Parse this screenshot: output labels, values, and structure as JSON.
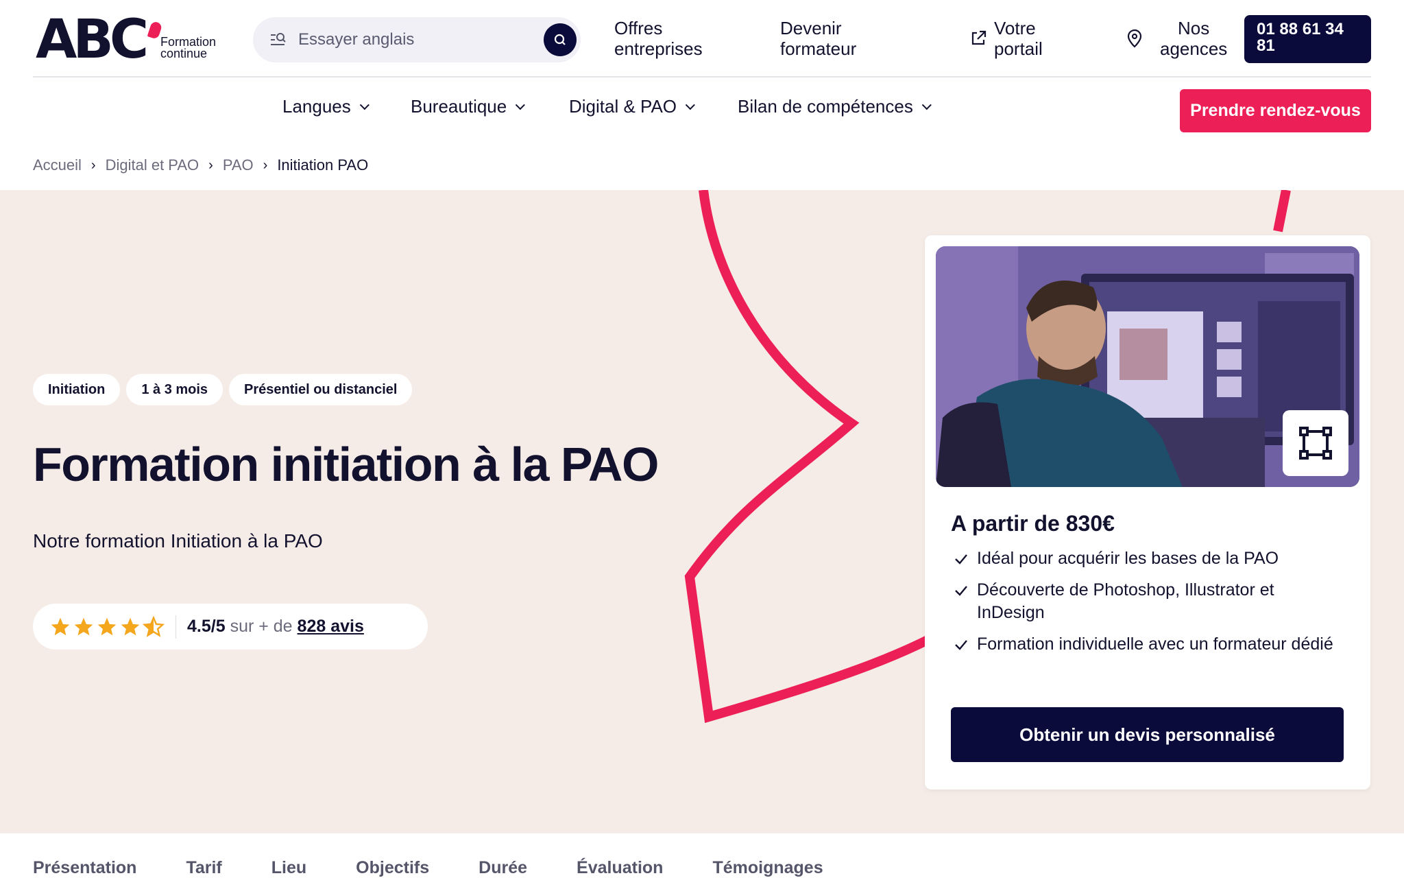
{
  "brand": {
    "logo_main": "ABC",
    "logo_sub_line1": "Formation",
    "logo_sub_line2": "continue",
    "accent_color": "#ed1f57",
    "dark_color": "#0b0b3b"
  },
  "search": {
    "placeholder": "Essayer anglais",
    "icon": "search-icon"
  },
  "top_links": {
    "offres_line1": "Offres",
    "offres_line2": "entreprises",
    "devenir_line1": "Devenir",
    "devenir_line2": "formateur",
    "portail_line1": "Votre",
    "portail_line2": "portail",
    "agences_line1": "Nos",
    "agences_line2": "agences",
    "phone_line1": "01 88 61 34",
    "phone_line2": "81"
  },
  "menu": {
    "items": [
      {
        "label": "Langues"
      },
      {
        "label": "Bureautique"
      },
      {
        "label": "Digital & PAO"
      },
      {
        "label": "Bilan de compétences"
      }
    ],
    "cta": "Prendre rendez-vous"
  },
  "breadcrumb": {
    "items": [
      "Accueil",
      "Digital et PAO",
      "PAO"
    ],
    "current": "Initiation PAO"
  },
  "hero": {
    "tags": [
      "Initiation",
      "1 à 3 mois",
      "Présentiel ou distanciel"
    ],
    "title": "Formation initiation à la PAO",
    "subtitle": "Notre formation Initiation à la PAO",
    "rating": {
      "stars": 4.5,
      "max": 5,
      "score": "4.5/5",
      "connector": "sur + de",
      "reviews_link": "828 avis"
    }
  },
  "card": {
    "price": "A partir de 830€",
    "features": [
      "Idéal pour acquérir les bases de la PAO",
      "Découverte de Photoshop, Illustrator et InDesign",
      "Formation individuelle avec un formateur dédié"
    ],
    "cta": "Obtenir un devis personnalisé"
  },
  "tabs": [
    "Présentation",
    "Tarif",
    "Lieu",
    "Objectifs",
    "Durée",
    "Évaluation",
    "Témoignages"
  ]
}
